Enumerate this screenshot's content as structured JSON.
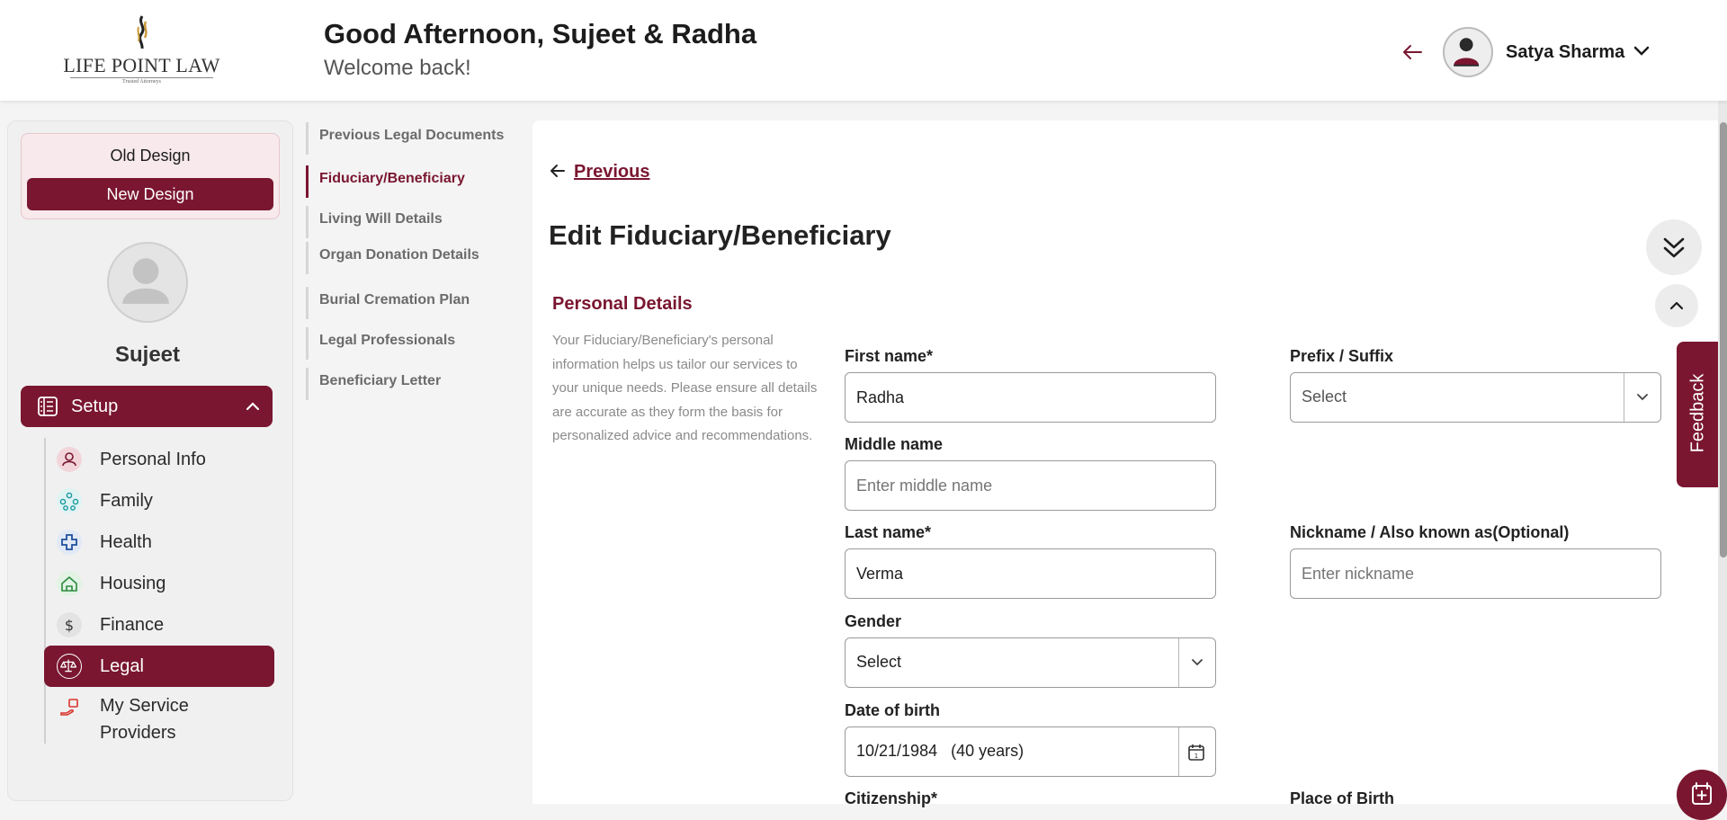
{
  "header": {
    "logo_text": "LIFE POINT LAW",
    "logo_tagline": "Trusted Attorneys",
    "greeting": "Good Afternoon, Sujeet & Radha",
    "welcome": "Welcome back!",
    "user_name": "Satya Sharma"
  },
  "sidebar": {
    "old_design": "Old Design",
    "new_design": "New Design",
    "profile_name": "Sujeet",
    "setup_label": "Setup",
    "items": [
      {
        "label": "Personal Info",
        "icon": "user-icon"
      },
      {
        "label": "Family",
        "icon": "family-icon"
      },
      {
        "label": "Health",
        "icon": "health-cross-icon"
      },
      {
        "label": "Housing",
        "icon": "house-icon"
      },
      {
        "label": "Finance",
        "icon": "dollar-icon"
      },
      {
        "label": "Legal",
        "icon": "scales-icon",
        "active": true
      },
      {
        "label": "My Service",
        "label2": "Providers",
        "icon": "service-hand-icon"
      }
    ]
  },
  "subnav": {
    "items": [
      {
        "label": "Previous Legal Documents"
      },
      {
        "label": "Fiduciary/Beneficiary",
        "active": true
      },
      {
        "label": "Living Will Details"
      },
      {
        "label": "Organ Donation Details"
      },
      {
        "label": "Burial Cremation Plan"
      },
      {
        "label": "Legal Professionals"
      },
      {
        "label": "Beneficiary Letter"
      }
    ]
  },
  "main": {
    "previous_label": "Previous",
    "title": "Edit Fiduciary/Beneficiary",
    "section_title": "Personal Details",
    "section_description": "Your Fiduciary/Beneficiary's personal information helps us tailor our services to your unique needs. Please ensure all details are accurate as they form the basis for personalized advice and recommendations.",
    "fields": {
      "first_name": {
        "label": "First name*",
        "value": "Radha"
      },
      "prefix_suffix": {
        "label": "Prefix / Suffix",
        "value": "Select"
      },
      "middle_name": {
        "label": "Middle name",
        "placeholder": "Enter middle name"
      },
      "last_name": {
        "label": "Last name*",
        "value": "Verma"
      },
      "nickname": {
        "label": "Nickname / Also known as(Optional)",
        "placeholder": "Enter nickname"
      },
      "gender": {
        "label": "Gender",
        "value": "Select"
      },
      "dob": {
        "label": "Date of birth",
        "value": "10/21/1984",
        "age": "(40 years)"
      },
      "citizenship": {
        "label": "Citizenship*"
      },
      "place_of_birth": {
        "label": "Place of Birth"
      }
    }
  },
  "feedback_label": "Feedback",
  "colors": {
    "brand": "#7a1630",
    "brand_light": "#f7e9ec"
  }
}
